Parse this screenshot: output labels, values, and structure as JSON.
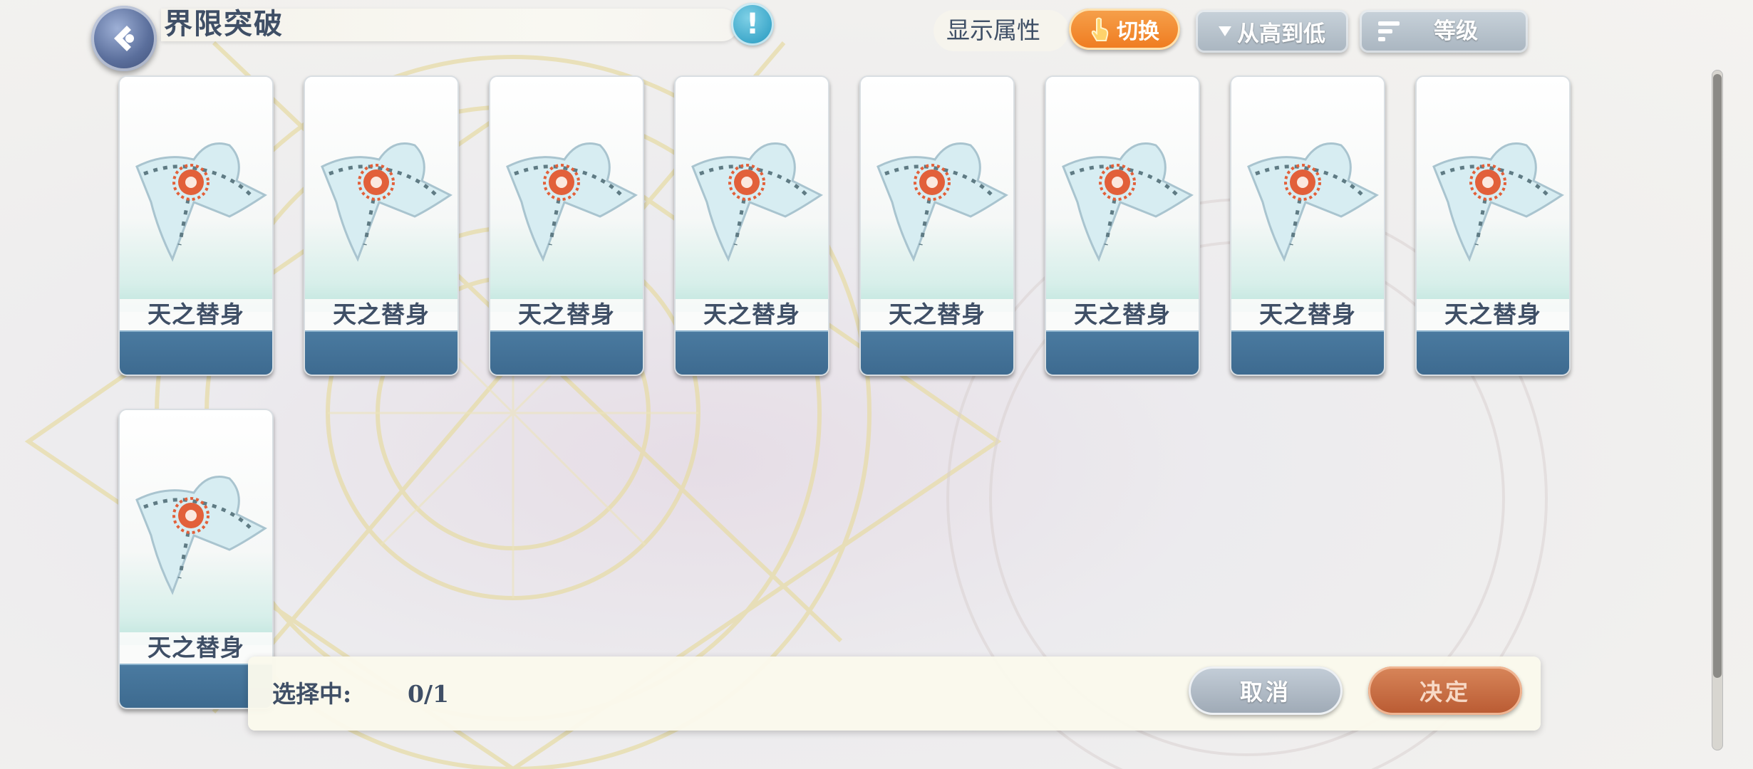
{
  "header": {
    "title": "界限突破",
    "info_label": "!",
    "display_attr_label": "显示属性",
    "switch_label": "切换",
    "sort_order_label": "从高到低",
    "sort_key_label": "等级"
  },
  "cards": [
    {
      "name": "天之替身"
    },
    {
      "name": "天之替身"
    },
    {
      "name": "天之替身"
    },
    {
      "name": "天之替身"
    },
    {
      "name": "天之替身"
    },
    {
      "name": "天之替身"
    },
    {
      "name": "天之替身"
    },
    {
      "name": "天之替身"
    },
    {
      "name": "天之替身"
    }
  ],
  "selection": {
    "label": "选择中:",
    "count": "0/1"
  },
  "actions": {
    "cancel_label": "取消",
    "confirm_label": "决定"
  },
  "colors": {
    "accent_orange": "#ef7b1f",
    "card_footer_blue": "#3d6a8f",
    "confirm_rust": "#b95a32",
    "text_slate": "#3f4f66"
  }
}
